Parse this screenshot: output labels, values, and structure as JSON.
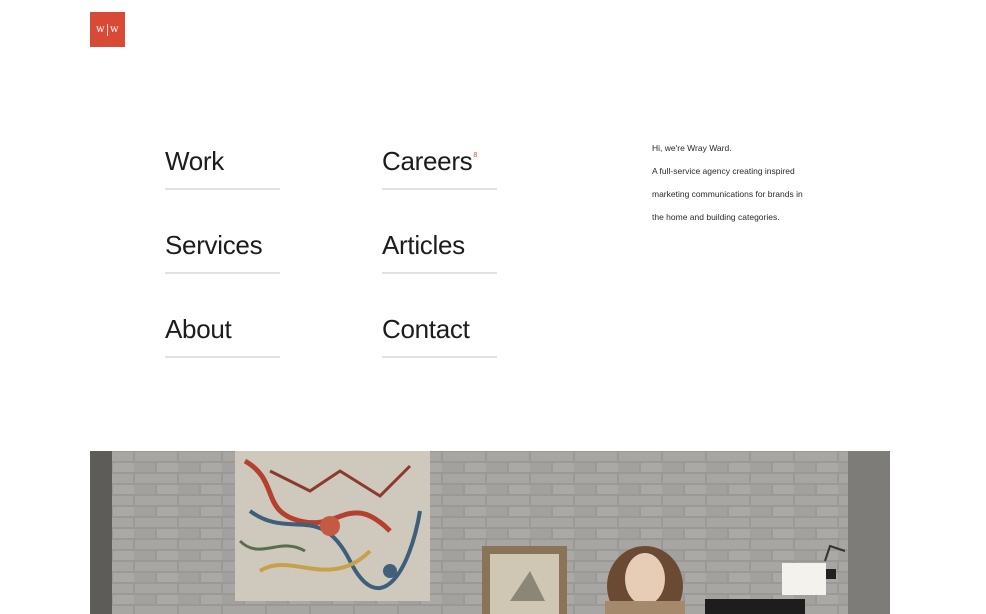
{
  "logo": {
    "left_letter": "w",
    "right_letter": "w"
  },
  "nav": {
    "work": "Work",
    "services": "Services",
    "about": "About",
    "careers": "Careers",
    "careers_badge": "8",
    "articles": "Articles",
    "contact": "Contact"
  },
  "intro": {
    "greeting": "Hi, we're Wray Ward.",
    "line1": "A full-service agency creating inspired",
    "line2": "marketing communications for brands in",
    "line3": "the home and building categories."
  },
  "colors": {
    "brand": "#d94a36",
    "text": "#1c1c1c",
    "rule": "#e2e2e2"
  },
  "icons": {
    "logo": "ww-monogram-logo"
  }
}
